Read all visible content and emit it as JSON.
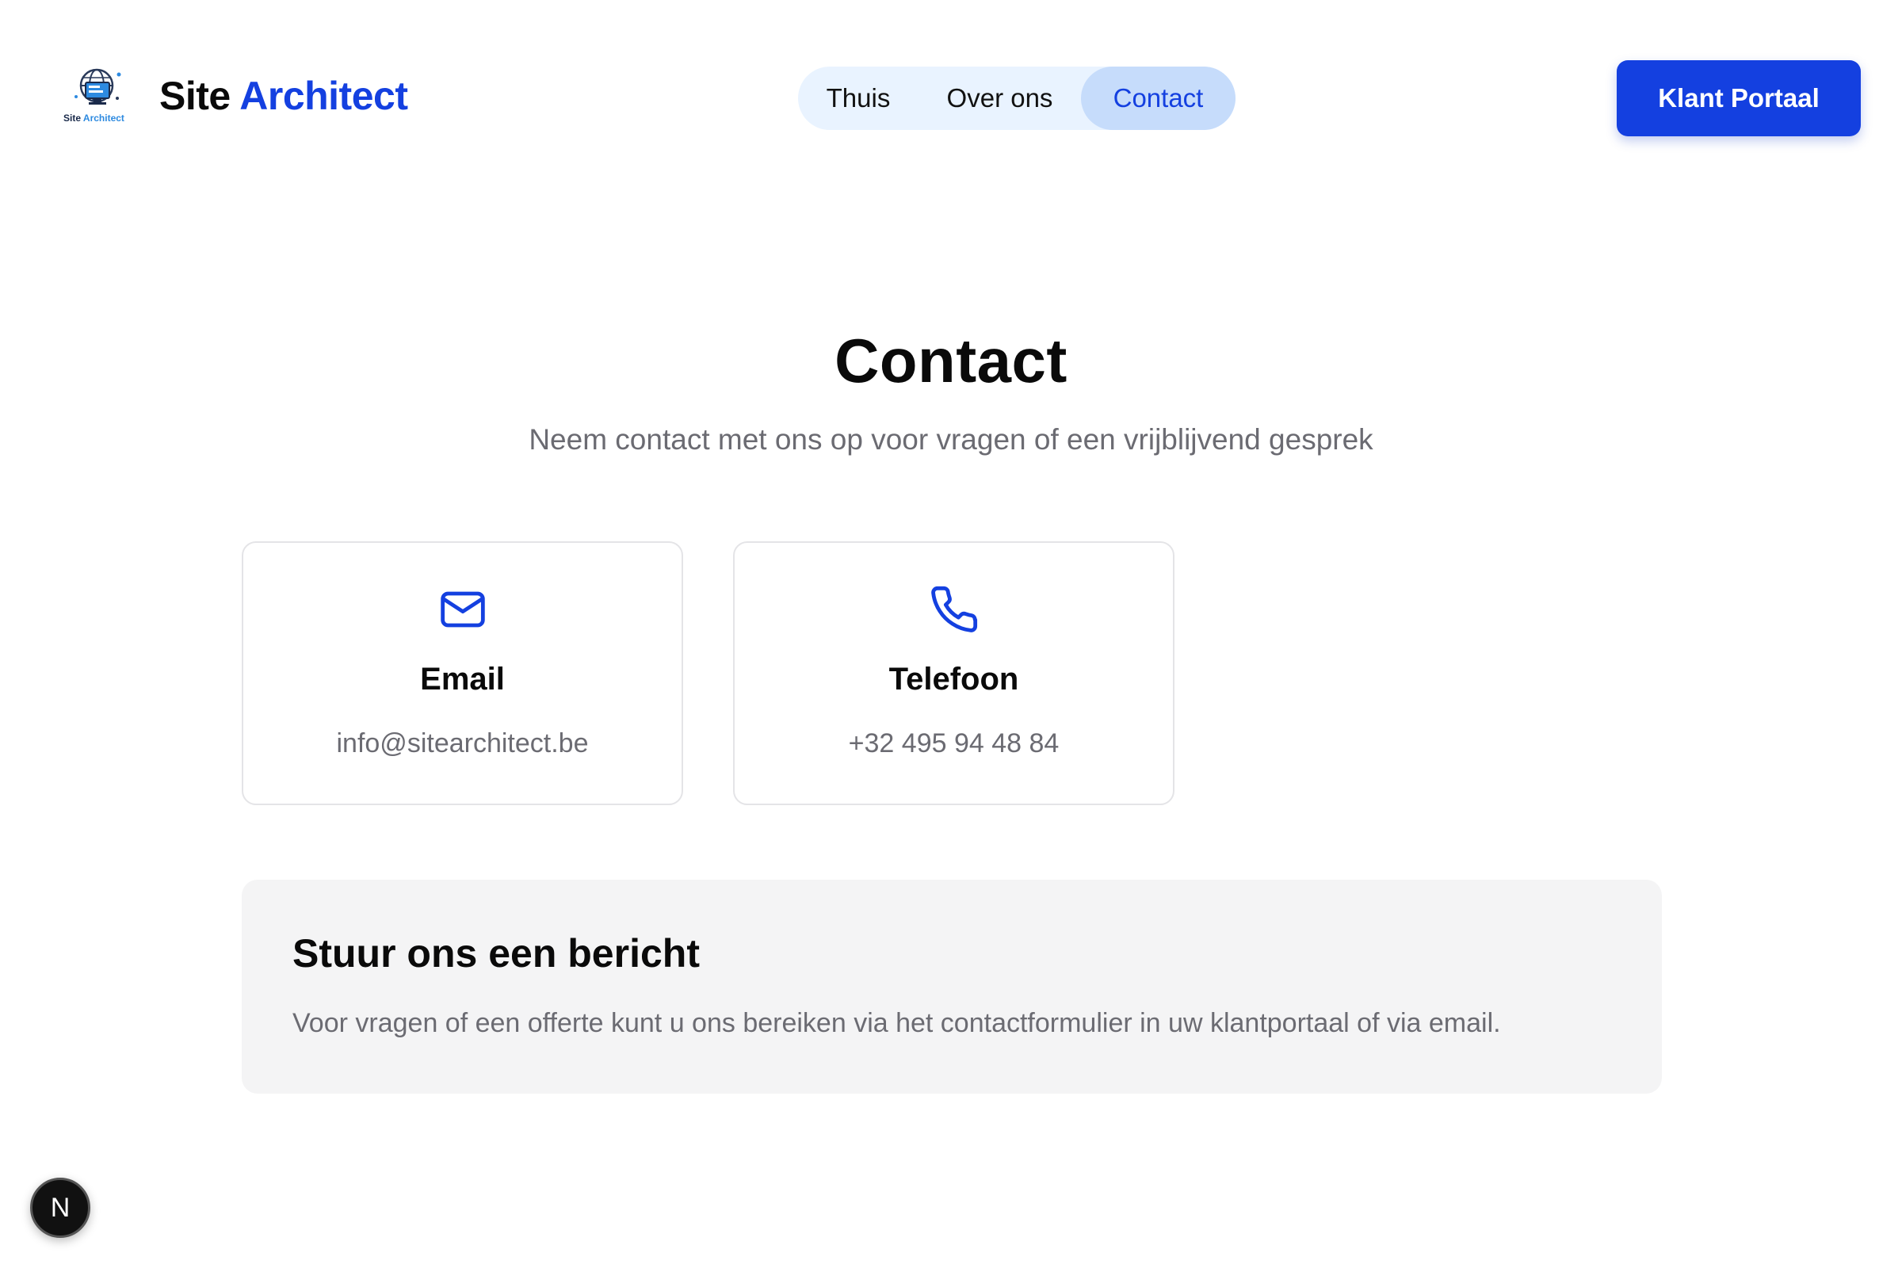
{
  "theme": {
    "accent": "#1440e0"
  },
  "header": {
    "logo": {
      "icon": "globe-monitor-icon",
      "mini_text_primary": "Site",
      "mini_text_accent": "Architect"
    },
    "brand_primary": "Site",
    "brand_accent": "Architect",
    "nav": [
      {
        "label": "Thuis",
        "active": false
      },
      {
        "label": "Over ons",
        "active": false
      },
      {
        "label": "Contact",
        "active": true
      }
    ],
    "portal_button": "Klant Portaal"
  },
  "hero": {
    "title": "Contact",
    "subtitle": "Neem contact met ons op voor vragen of een vrijblijvend gesprek"
  },
  "cards": [
    {
      "icon": "mail-icon",
      "title": "Email",
      "value": "info@sitearchitect.be"
    },
    {
      "icon": "phone-icon",
      "title": "Telefoon",
      "value": "+32 495 94 48 84"
    }
  ],
  "message": {
    "title": "Stuur ons een bericht",
    "text": "Voor vragen of een offerte kunt u ons bereiken via het contactformulier in uw klantportaal of via email."
  },
  "dev_badge": {
    "icon": "next-logo-icon",
    "letter": "N"
  }
}
